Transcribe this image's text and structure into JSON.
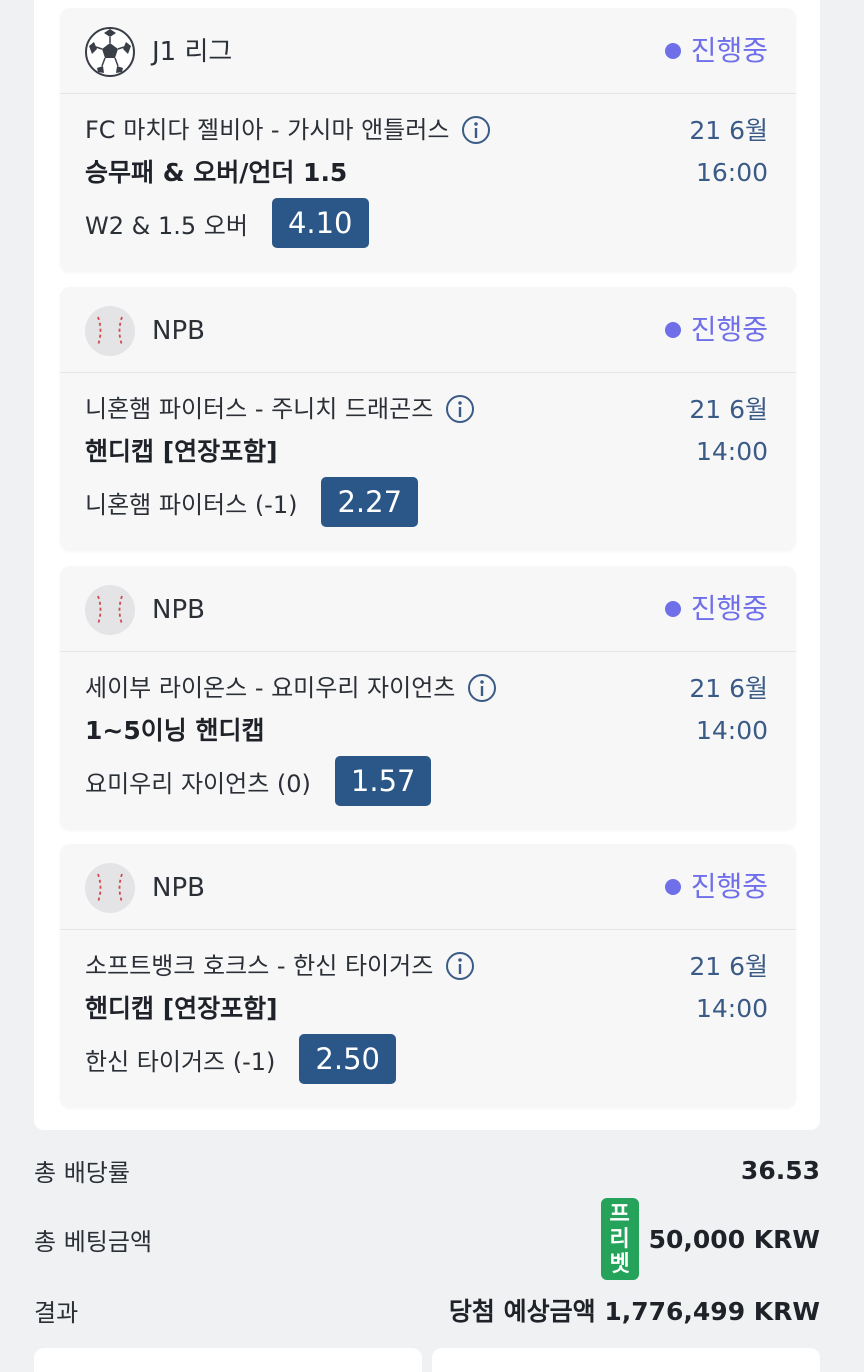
{
  "bets": [
    {
      "league": "J1 리그",
      "league_icon": "soccer-ball-icon",
      "status": "진행중",
      "match": "FC 마치다 젤비아 - 가시마 앤틀러스",
      "market": "승무패 & 오버/언더 1.5",
      "pick": "W2 & 1.5 오버",
      "odds": "4.10",
      "date": "21 6월",
      "time": "16:00"
    },
    {
      "league": "NPB",
      "league_icon": "baseball-icon",
      "status": "진행중",
      "match": "니혼햄 파이터스 - 주니치 드래곤즈",
      "market": "핸디캡 [연장포함]",
      "pick": "니혼햄 파이터스 (-1)",
      "odds": "2.27",
      "date": "21 6월",
      "time": "14:00"
    },
    {
      "league": "NPB",
      "league_icon": "baseball-icon",
      "status": "진행중",
      "match": "세이부 라이온스 - 요미우리 자이언츠",
      "market": "1~5이닝 핸디캡",
      "pick": "요미우리 자이언츠 (0)",
      "odds": "1.57",
      "date": "21 6월",
      "time": "14:00"
    },
    {
      "league": "NPB",
      "league_icon": "baseball-icon",
      "status": "진행중",
      "match": "소프트뱅크 호크스 - 한신 타이거즈",
      "market": "핸디캡 [연장포함]",
      "pick": "한신 타이거즈 (-1)",
      "odds": "2.50",
      "date": "21 6월",
      "time": "14:00"
    }
  ],
  "summary": {
    "total_odds_label": "총 배당률",
    "total_odds_value": "36.53",
    "total_stake_label": "총 베팅금액",
    "freebet_badge": [
      "프",
      "리",
      "벳"
    ],
    "total_stake_value": "50,000 KRW",
    "result_label": "결과",
    "result_value": "당첨 예상금액 1,776,499 KRW"
  },
  "colors": {
    "status": "#6f6fea",
    "odds_bg": "#2a5787",
    "date_text": "#3b5b87",
    "freebet_bg": "#25a35a"
  }
}
